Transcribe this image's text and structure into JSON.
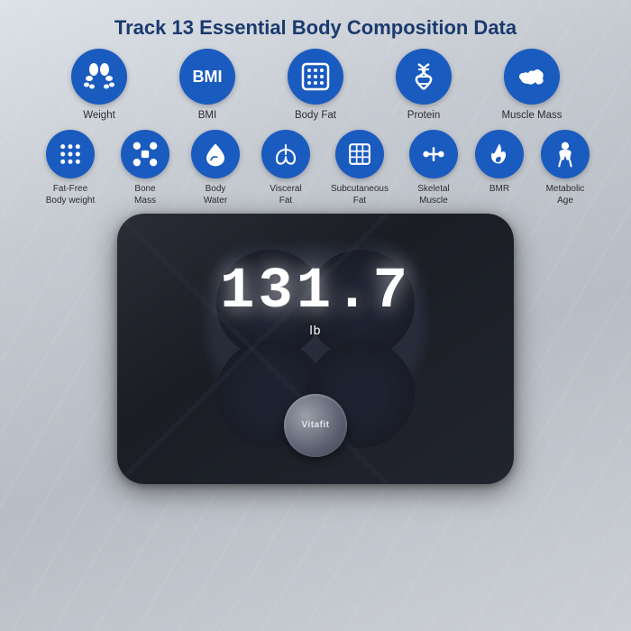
{
  "page": {
    "title": "Track 13 Essential Body Composition Data",
    "background": "#c8cdd4"
  },
  "row1": [
    {
      "id": "weight",
      "label": "Weight",
      "icon_type": "feet"
    },
    {
      "id": "bmi",
      "label": "BMI",
      "icon_type": "bmi_text"
    },
    {
      "id": "body-fat",
      "label": "Body Fat",
      "icon_type": "grid"
    },
    {
      "id": "protein",
      "label": "Protein",
      "icon_type": "dna"
    },
    {
      "id": "muscle-mass",
      "label": "Muscle Mass",
      "icon_type": "muscle"
    }
  ],
  "row2": [
    {
      "id": "fat-free",
      "label": "Fat-Free\nBody weight",
      "icon_type": "dots"
    },
    {
      "id": "bone-mass",
      "label": "Bone\nMass",
      "icon_type": "bone"
    },
    {
      "id": "body-water",
      "label": "Body\nWater",
      "icon_type": "drop"
    },
    {
      "id": "visceral-fat",
      "label": "Visceral\nFat",
      "icon_type": "lungs"
    },
    {
      "id": "subcutaneous",
      "label": "Subcutaneous\nFat",
      "icon_type": "grid2"
    },
    {
      "id": "skeletal",
      "label": "Skeletal\nMuscle",
      "icon_type": "skeletal"
    },
    {
      "id": "bmr",
      "label": "BMR",
      "icon_type": "flame"
    },
    {
      "id": "metabolic",
      "label": "Metabolic\nAge",
      "icon_type": "person"
    }
  ],
  "scale": {
    "display": "131.7",
    "unit": "lb",
    "brand": "Vitafit"
  }
}
